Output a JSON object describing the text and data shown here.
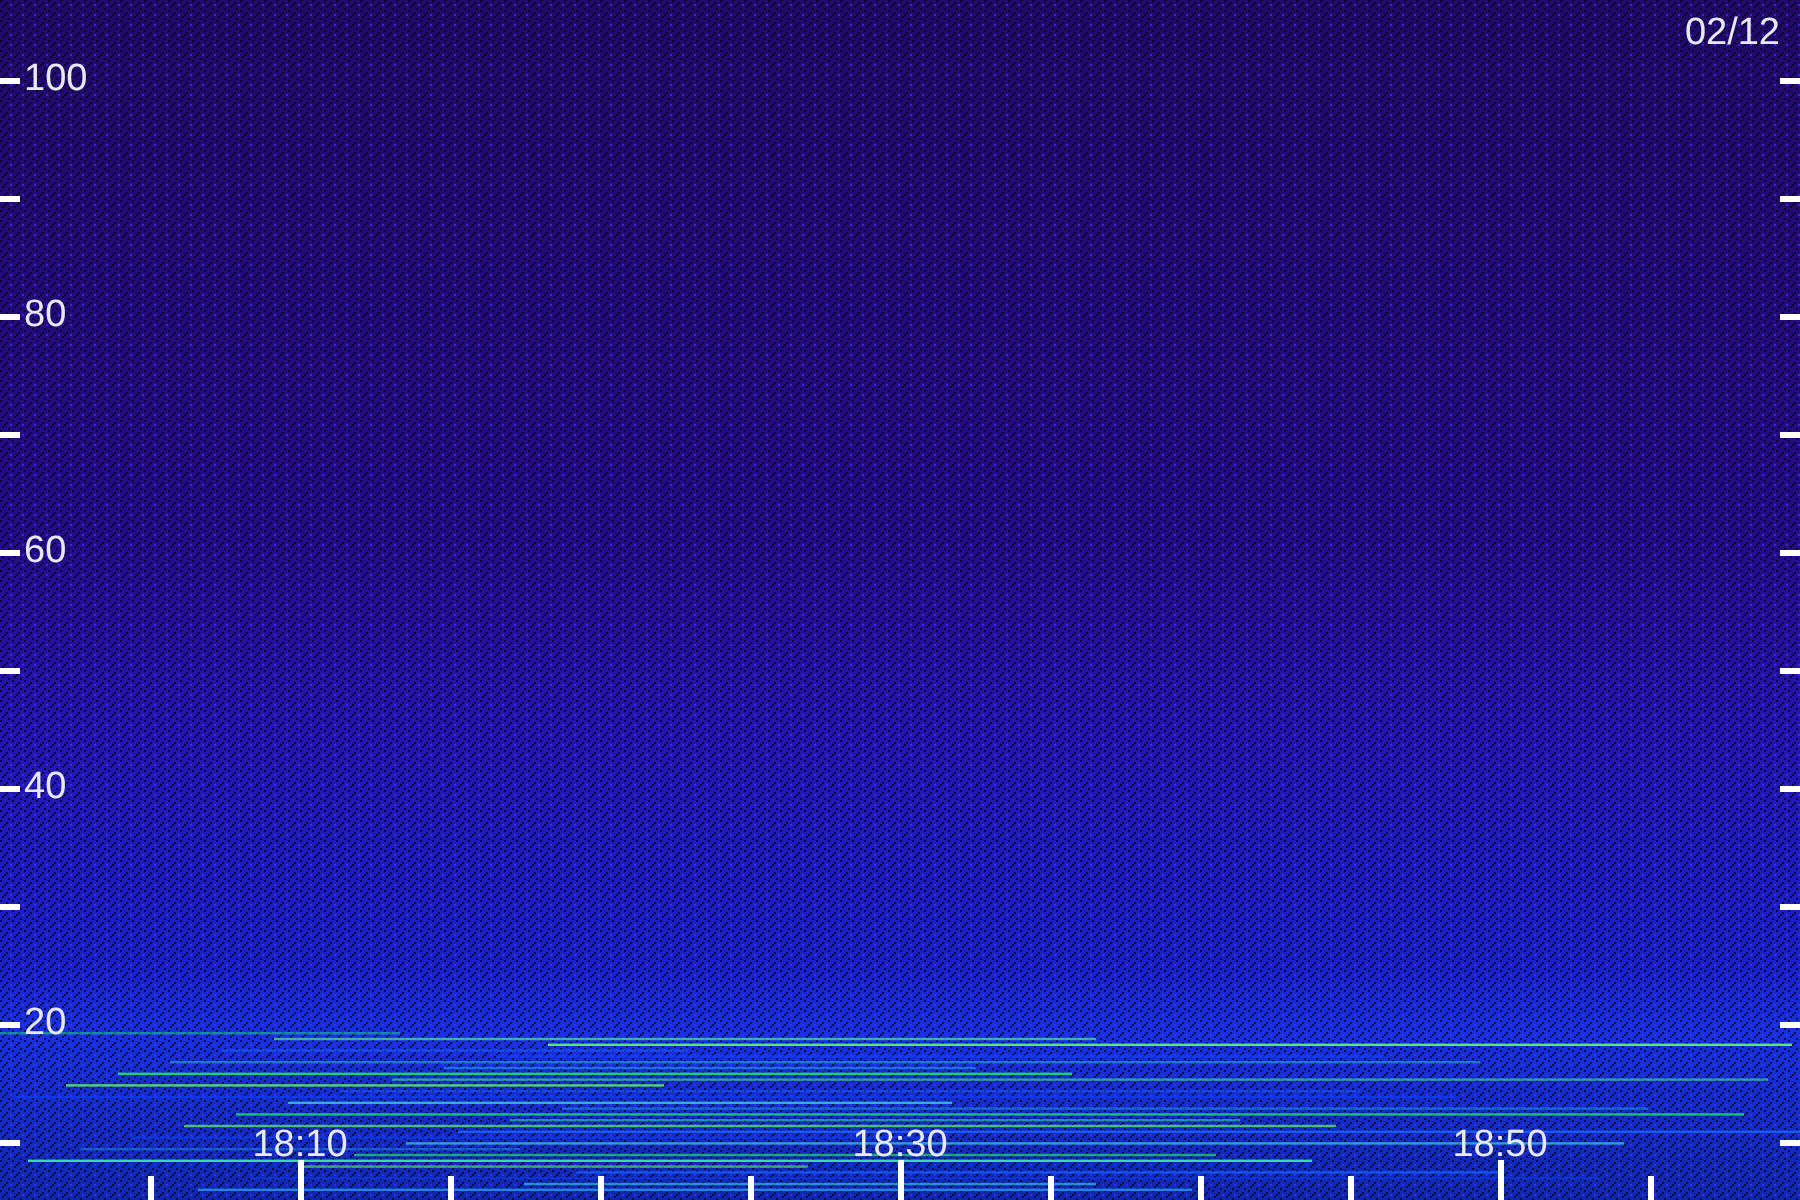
{
  "spectrogram": {
    "date": "02/12",
    "y_axis_labels": [
      "100",
      "80",
      "60",
      "40",
      "20"
    ],
    "x_axis_labels": [
      "18:10",
      "18:30",
      "18:50"
    ]
  }
}
